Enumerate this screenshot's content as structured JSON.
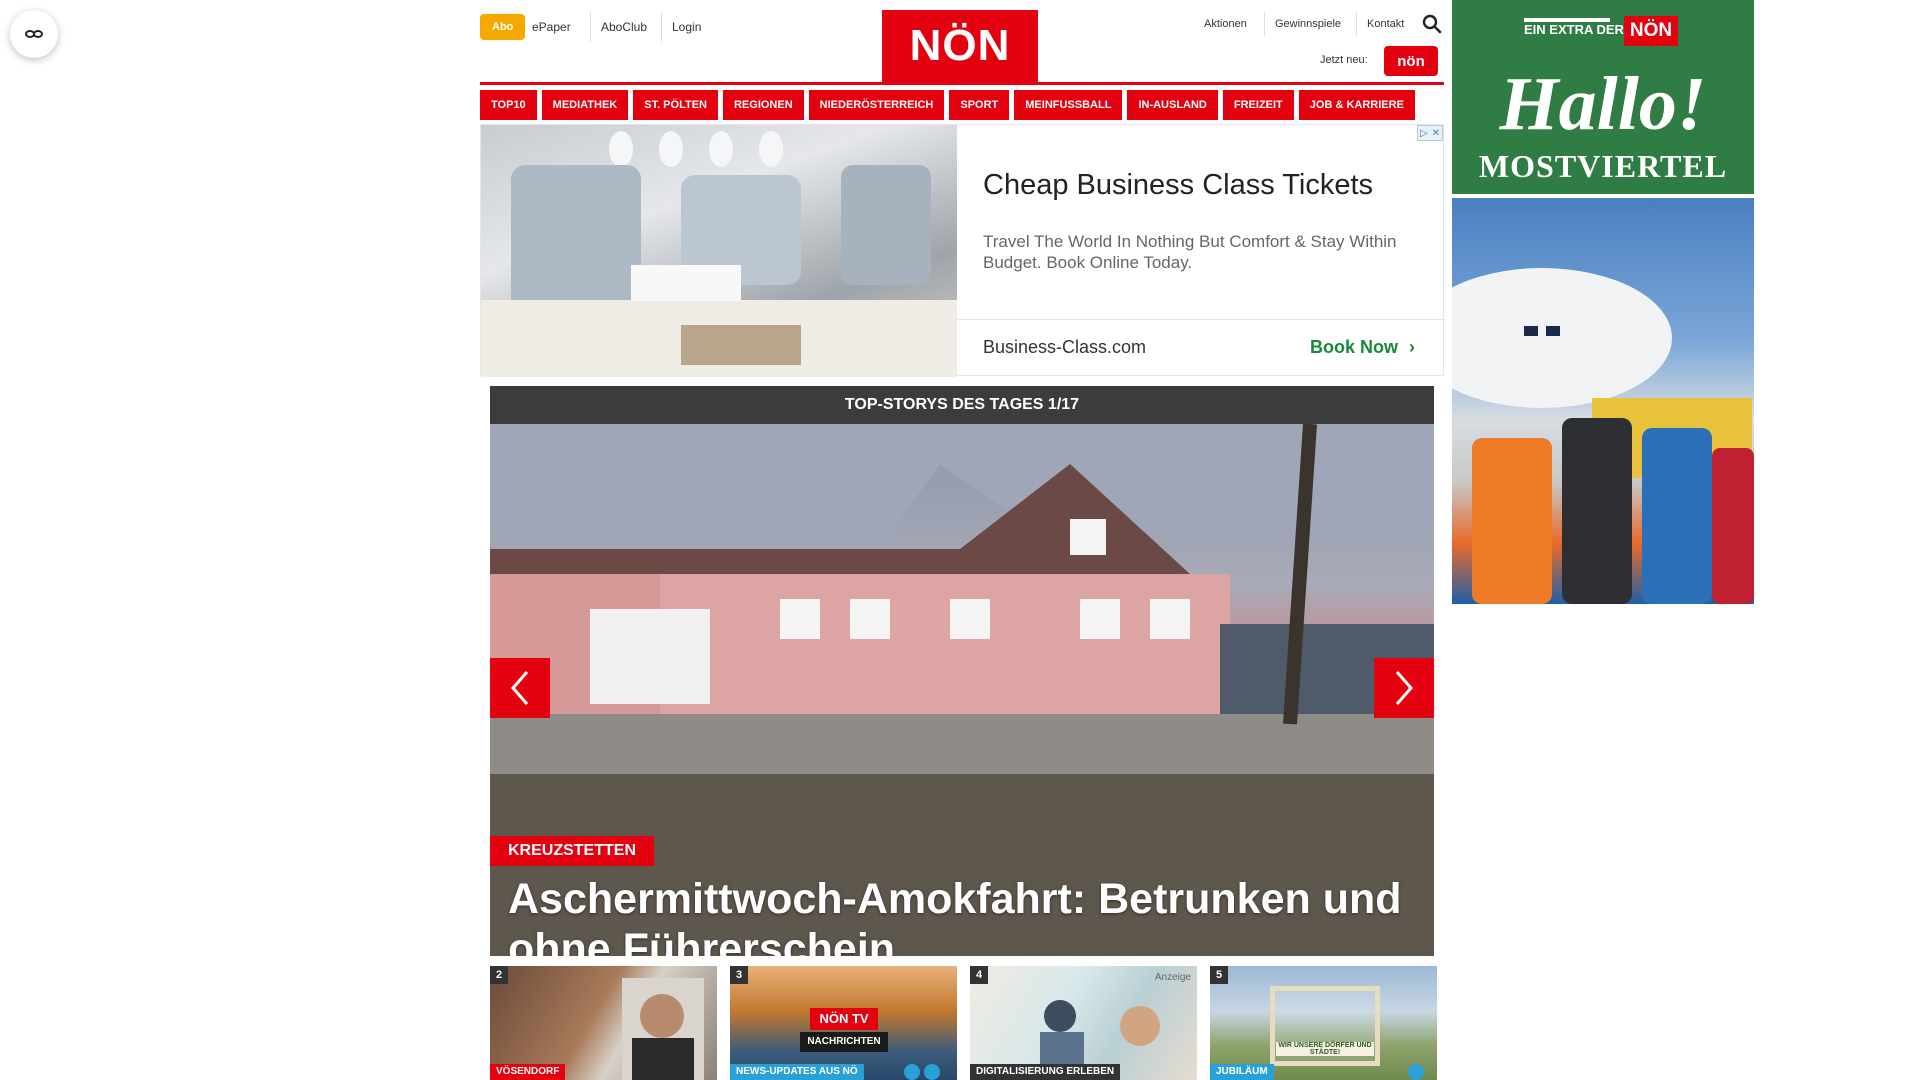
{
  "header": {
    "abo_label": "Abo",
    "links_left": [
      "ePaper",
      "AboClub",
      "Login"
    ],
    "logo": "NÖN",
    "links_right": [
      "Aktionen",
      "Gewinnspiele",
      "Kontakt"
    ],
    "jetzt_neu": "Jetzt neu:",
    "jetzt_badge": "nön"
  },
  "nav": {
    "items": [
      "TOP10",
      "MEDIATHEK",
      "ST. PÖLTEN",
      "REGIONEN",
      "NIEDERÖSTERREICH",
      "SPORT",
      "MEINFUSSBALL",
      "IN-AUSLAND",
      "FREIZEIT",
      "JOB & KARRIERE"
    ]
  },
  "ad": {
    "title": "Cheap Business Class Tickets",
    "description": "Travel The World In Nothing But Comfort & Stay Within Budget. Book Online Today.",
    "domain": "Business-Class.com",
    "cta": "Book Now"
  },
  "top_story": {
    "header": "TOP-STORYS DES TAGES 1/17",
    "kicker": "KREUZSTETTEN",
    "headline": "Aschermittwoch-Amokfahrt: Betrunken und ohne Führerschein"
  },
  "thumbs": [
    {
      "num": "2",
      "tag": "VÖSENDORF",
      "tag_color": "#e3000f"
    },
    {
      "num": "3",
      "tag": "NEWS-UPDATES AUS NÖ",
      "tag_color": "#2aa0d8",
      "overlay_title": "NÖN TV",
      "overlay_sub": "NACHRICHTEN"
    },
    {
      "num": "4",
      "tag": "DIGITALISIERUNG ERLEBEN",
      "tag_color": "#333333",
      "badge": "Anzeige"
    },
    {
      "num": "5",
      "tag": "JUBILÄUM",
      "tag_color": "#2aa0d8",
      "sign": "WIR UNSERE DÖRFER UND STÄDTE!"
    }
  ],
  "sidebar_ad": {
    "extra_text": "EIN EXTRA DER",
    "extra_logo": "NÖN",
    "hallo": "Hallo!",
    "region": "MOSTVIERTEL"
  },
  "colors": {
    "brand_red": "#e3000f",
    "abo_orange": "#f5a800",
    "ad_cta_green": "#1a8a3a",
    "sidebar_green": "#2f7d45",
    "story_header": "#3c3c3c"
  }
}
